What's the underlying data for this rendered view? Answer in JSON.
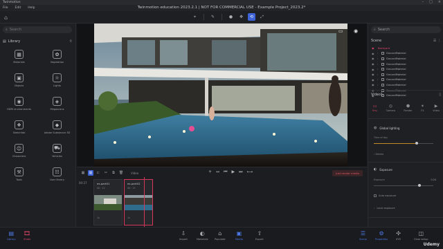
{
  "app": {
    "name": "Twinmotion",
    "doc_title": "Twinmotion education 2023.2.1 | NOT FOR COMMERCIAL USE - Example Project_2023.2*"
  },
  "menu": [
    "File",
    "Edit",
    "Help"
  ],
  "colors": {
    "accent": "#3d63d6",
    "highlight": "#e2456b",
    "bg": "#1b1c1f"
  },
  "left_panel": {
    "search_placeholder": "Search",
    "library_title": "Library",
    "items": [
      {
        "label": "Materials",
        "icon": "materials-icon",
        "glyph": "▦"
      },
      {
        "label": "Vegetation",
        "icon": "vegetation-icon",
        "glyph": "✿"
      },
      {
        "label": "Objects",
        "icon": "objects-icon",
        "glyph": "▣"
      },
      {
        "label": "Lights",
        "icon": "lights-icon",
        "glyph": "☼"
      },
      {
        "label": "HDRI environments",
        "icon": "hdri-icon",
        "glyph": "◉"
      },
      {
        "label": "Megascans",
        "icon": "megascans-icon",
        "glyph": "◈"
      },
      {
        "label": "Sketchfab",
        "icon": "sketchfab-icon",
        "glyph": "❖"
      },
      {
        "label": "Adobe Substance 3D",
        "icon": "substance-icon",
        "glyph": "◆"
      },
      {
        "label": "Characters",
        "icon": "characters-icon",
        "glyph": "☺"
      },
      {
        "label": "Vehicles",
        "icon": "vehicles-icon",
        "glyph": "⛟"
      },
      {
        "label": "Tools",
        "icon": "tools-icon",
        "glyph": "⚒"
      },
      {
        "label": "User library",
        "icon": "user-library-icon",
        "glyph": "☷"
      }
    ]
  },
  "timeline": {
    "video_label": "Video",
    "render_button": "Just render media",
    "time": "00:27",
    "clips": [
      {
        "name": "ex-part01",
        "sub": "00 : 12",
        "foot": "1s"
      },
      {
        "name": "ex-part02",
        "sub": "00 : 15",
        "foot": "1s"
      }
    ]
  },
  "right_panel": {
    "search_placeholder": "Search",
    "scene_title": "Scene",
    "tree": [
      {
        "label": "Backyard",
        "selected": true
      },
      {
        "label": "GroundMaterial"
      },
      {
        "label": "GroundMaterial"
      },
      {
        "label": "GroundMaterial"
      },
      {
        "label": "GroundMaterial"
      },
      {
        "label": "GroundMaterial"
      },
      {
        "label": "GroundMaterial"
      },
      {
        "label": "GroundMaterial"
      },
      {
        "label": "GroundMaterial"
      },
      {
        "label": "GroundMaterial"
      }
    ],
    "props_title": "Video1",
    "tabs": [
      {
        "label": "Env.",
        "icon": "env-icon",
        "glyph": "▭"
      },
      {
        "label": "Camera",
        "icon": "camera-icon",
        "glyph": "◎"
      },
      {
        "label": "Render",
        "icon": "render-icon",
        "glyph": "⬢"
      },
      {
        "label": "FX",
        "icon": "fx-icon",
        "glyph": "✶"
      },
      {
        "label": "Video",
        "icon": "video-icon",
        "glyph": "▶"
      }
    ],
    "global_lighting": "Global lighting",
    "time_of_day_label": "Time of day",
    "time_of_day_value": 0.72,
    "details_label": "Details",
    "exposure_title": "Exposure",
    "exposure_label": "Exposure",
    "exposure_value": "0.24",
    "auto_exposure": "Auto exposure",
    "local_exposure": "Local exposure"
  },
  "bottom_bar": {
    "left": [
      {
        "label": "Library",
        "icon": "library-icon",
        "glyph": "▤"
      },
      {
        "label": "Shots",
        "icon": "shots-icon",
        "glyph": "🎞"
      }
    ],
    "center": [
      {
        "label": "Import",
        "icon": "import-icon",
        "glyph": "⇩"
      },
      {
        "label": "Materials",
        "icon": "materials-tab-icon",
        "glyph": "◐"
      },
      {
        "label": "Populate",
        "icon": "populate-icon",
        "glyph": "⌂"
      },
      {
        "label": "Media",
        "icon": "media-icon",
        "glyph": "▣"
      },
      {
        "label": "Export",
        "icon": "export-icon",
        "glyph": "⇧"
      }
    ],
    "right": [
      {
        "label": "Scene",
        "icon": "scene-icon",
        "glyph": "☰"
      },
      {
        "label": "Properties",
        "icon": "properties-icon",
        "glyph": "⚙"
      },
      {
        "label": "XYZ",
        "icon": "xyz-icon",
        "glyph": "✣"
      },
      {
        "label": "Clear setup",
        "icon": "clear-setup-icon",
        "glyph": "◫"
      }
    ],
    "watermark": "Udemy"
  }
}
